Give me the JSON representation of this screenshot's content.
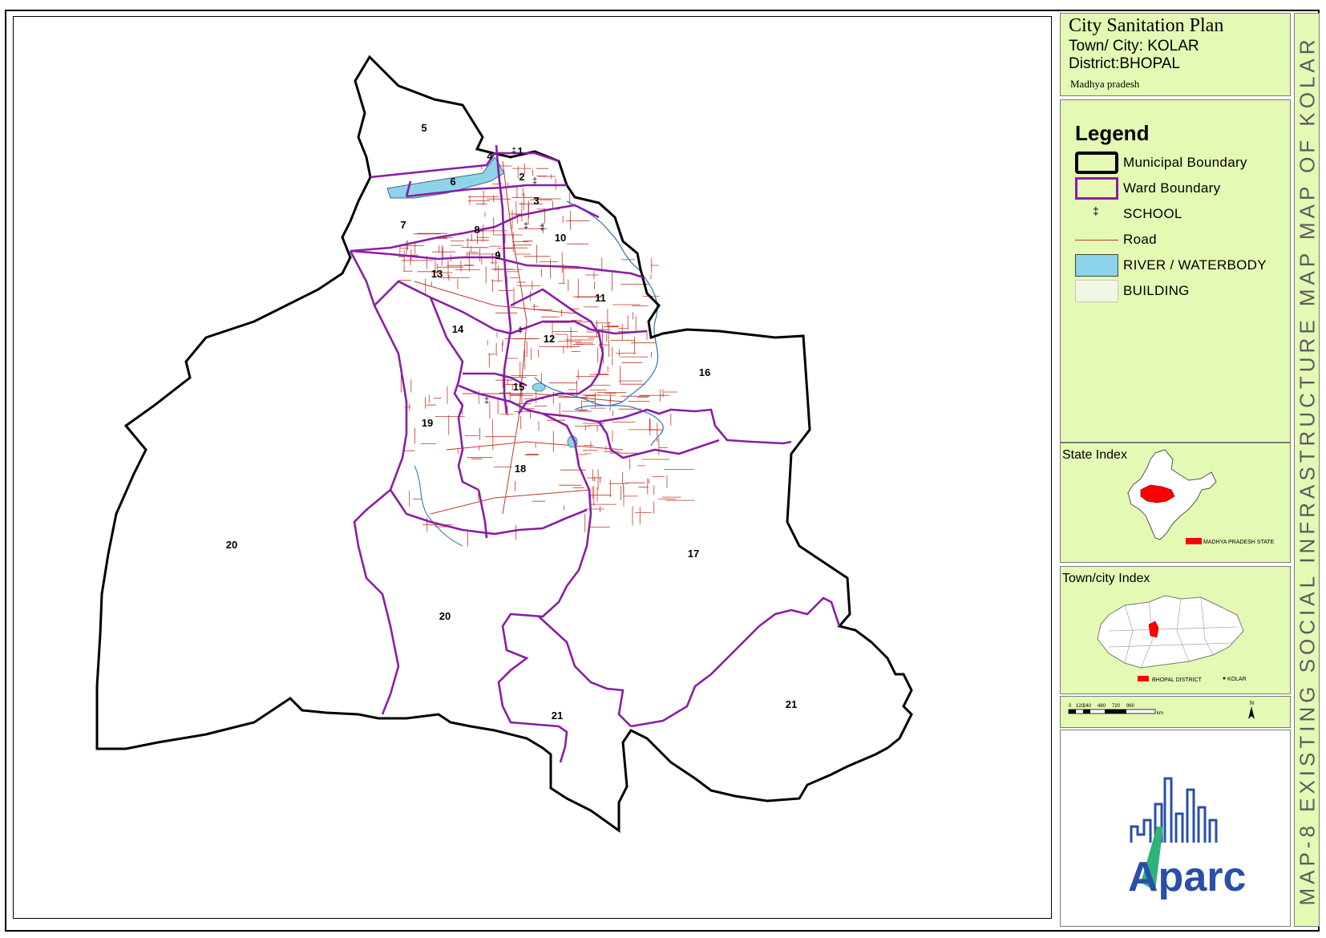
{
  "title": {
    "main": "City Sanitation Plan",
    "town": "Town/ City: KOLAR",
    "district": "District:BHOPAL",
    "state": "Madhya pradesh"
  },
  "legend": {
    "heading": "Legend",
    "items": [
      {
        "label": "Municipal Boundary",
        "symbol": "municipal-boundary-swatch"
      },
      {
        "label": "Ward Boundary",
        "symbol": "ward-boundary-swatch",
        "color": "#8a1ea6"
      },
      {
        "label": "SCHOOL",
        "symbol": "school-icon"
      },
      {
        "label": "Road",
        "symbol": "road-line",
        "color": "#c0392b"
      },
      {
        "label": "RIVER / WATERBODY",
        "symbol": "river-swatch",
        "color": "#8dd3ea"
      },
      {
        "label": "BUILDING",
        "symbol": "building-swatch",
        "color": "#f1f7e3"
      }
    ]
  },
  "state_index": {
    "title": "State Index",
    "legend_label": "MADHYA PRADESH STATE",
    "highlight_color": "#ff0000"
  },
  "town_index": {
    "title": "Town/city Index",
    "district_label": "BHOPAL DISTRICT",
    "town_label": "KOLAR",
    "highlight_color": "#ff0000"
  },
  "scale_bar": {
    "ticks": [
      "0",
      "120",
      "240",
      "480",
      "720",
      "960"
    ],
    "unit": "km",
    "north": "N"
  },
  "logo": {
    "text": "Aparc"
  },
  "side_title": "MAP-8 EXISTING SOCIAL INFRASTRUCTURE MAP MAP OF KOLAR",
  "wards": [
    {
      "label": "1"
    },
    {
      "label": "2"
    },
    {
      "label": "3"
    },
    {
      "label": "4"
    },
    {
      "label": "5"
    },
    {
      "label": "6"
    },
    {
      "label": "7"
    },
    {
      "label": "8"
    },
    {
      "label": "9"
    },
    {
      "label": "10"
    },
    {
      "label": "11"
    },
    {
      "label": "12"
    },
    {
      "label": "13"
    },
    {
      "label": "14"
    },
    {
      "label": "15"
    },
    {
      "label": "16"
    },
    {
      "label": "17"
    },
    {
      "label": "18"
    },
    {
      "label": "19"
    },
    {
      "label": "20"
    },
    {
      "label": "20"
    },
    {
      "label": "21"
    },
    {
      "label": "21"
    }
  ],
  "colors": {
    "panel_bg": "#e4f9b4",
    "ward_boundary": "#8a1ea6",
    "road": "#c0392b",
    "water": "#8dd3ea"
  }
}
